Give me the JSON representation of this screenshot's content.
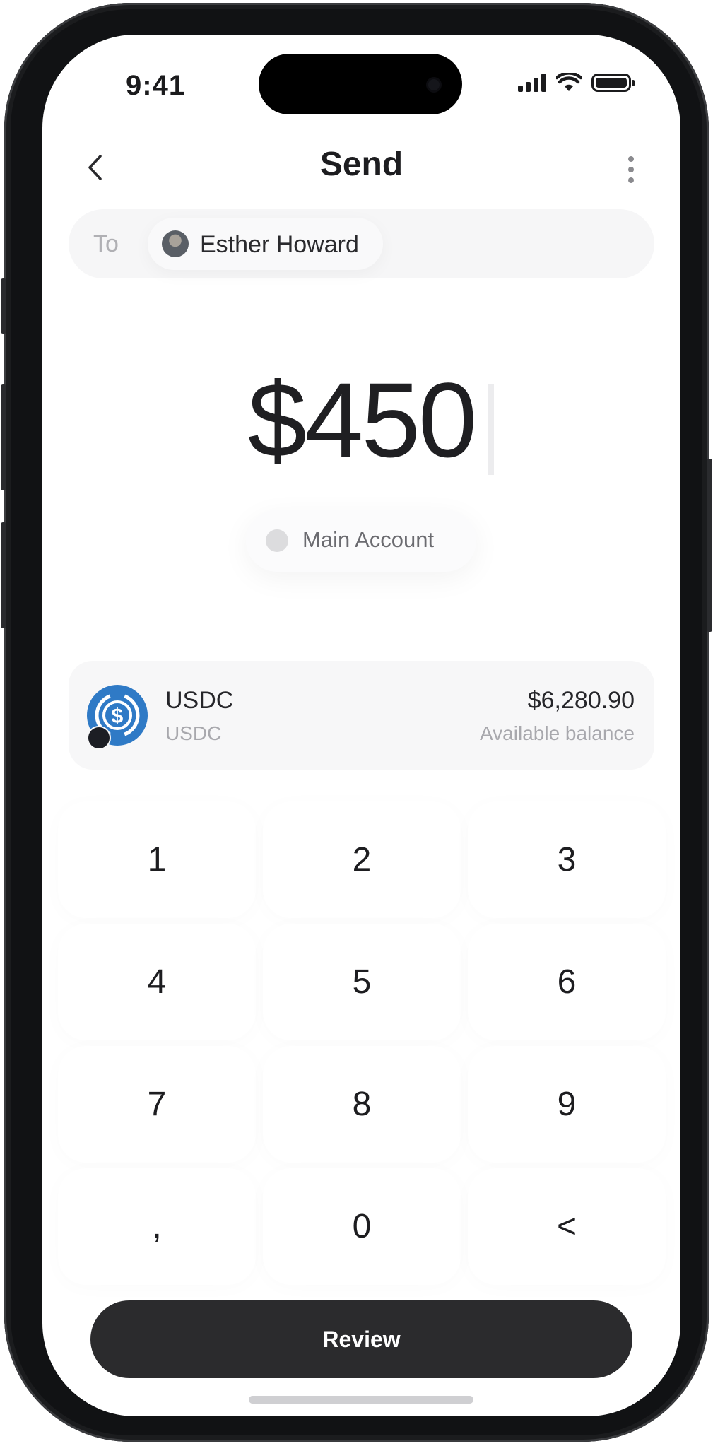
{
  "status_bar": {
    "time": "9:41"
  },
  "header": {
    "title": "Send"
  },
  "recipient": {
    "label": "To",
    "name": "Esther Howard"
  },
  "amount": {
    "value": "$450"
  },
  "account": {
    "name": "Main Account"
  },
  "asset": {
    "name": "USDC",
    "ticker": "USDC",
    "balance": "$6,280.90",
    "balance_label": "Available balance",
    "icon_color": "#2F7AC6"
  },
  "keypad": {
    "keys": [
      "1",
      "2",
      "3",
      "4",
      "5",
      "6",
      "7",
      "8",
      "9",
      ",",
      "0",
      "<"
    ]
  },
  "actions": {
    "review_label": "Review"
  },
  "colors": {
    "primary_button": "#2B2B2D",
    "background": "#FFFFFF"
  }
}
